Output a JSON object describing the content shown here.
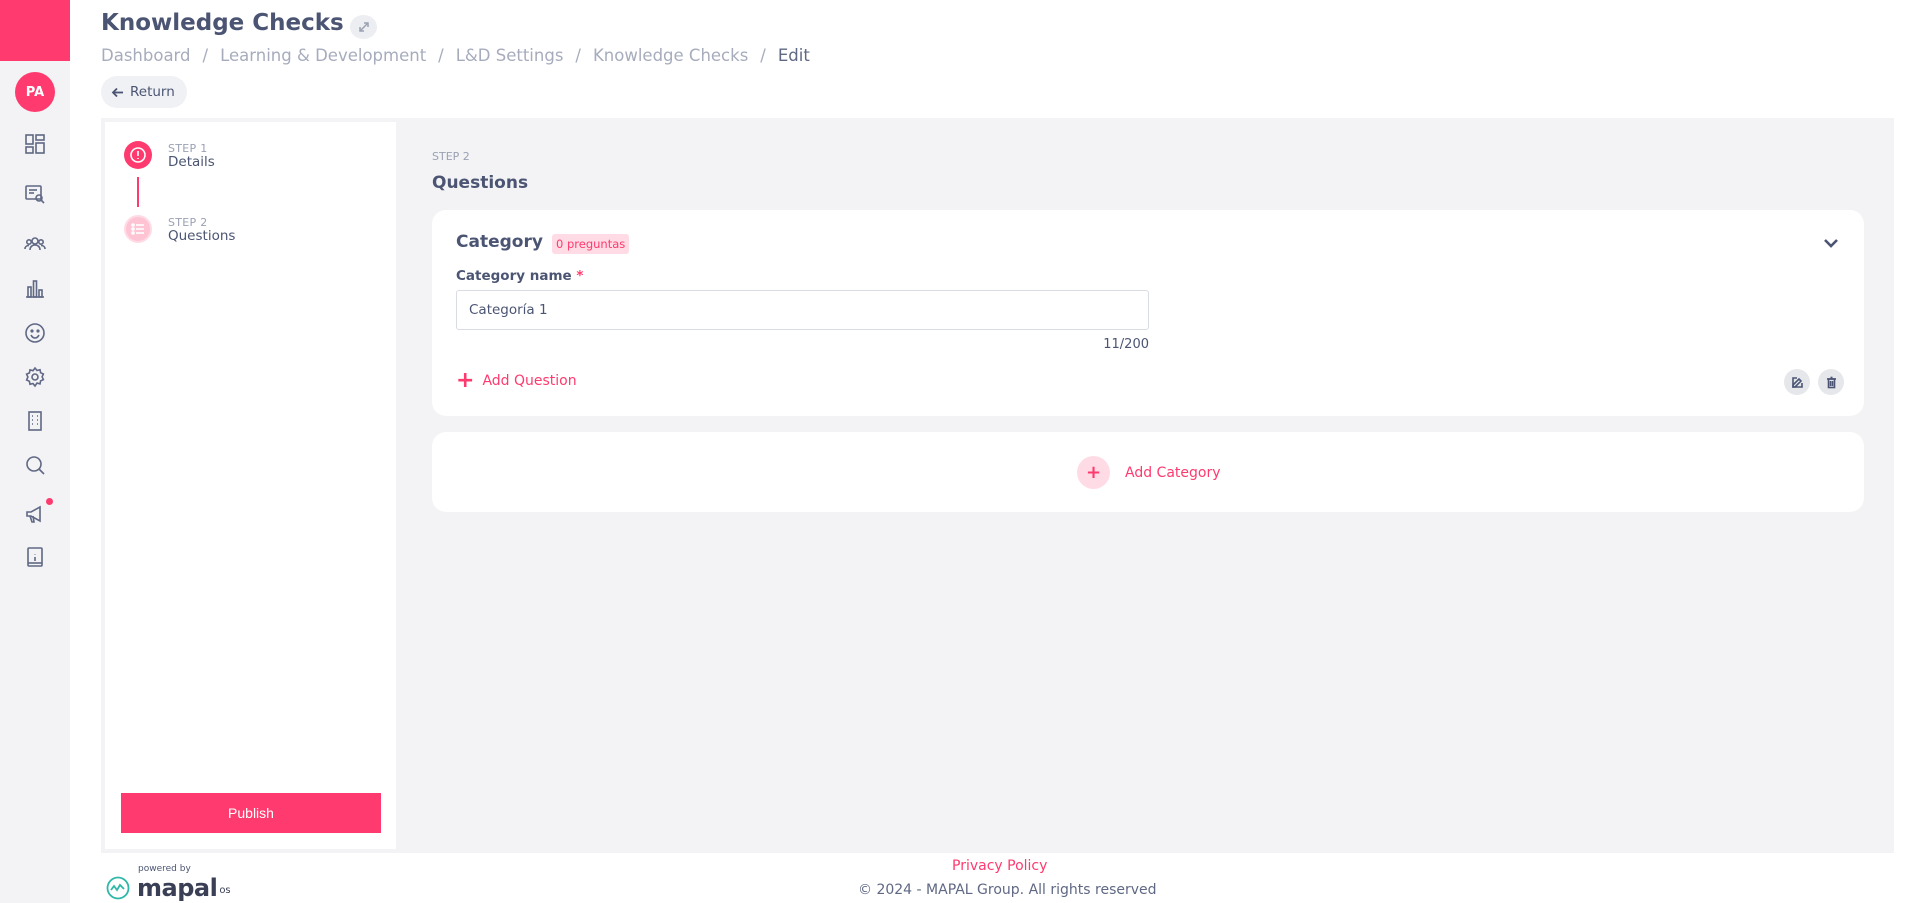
{
  "header": {
    "title": "Knowledge Checks",
    "breadcrumb": [
      "Dashboard",
      "Learning & Development",
      "L&D Settings",
      "Knowledge Checks",
      "Edit"
    ],
    "return_label": "Return"
  },
  "sidebar": {
    "avatar_initials": "PA",
    "icons": [
      "dashboard-icon",
      "search-document-icon",
      "people-icon",
      "chart-icon",
      "smile-icon",
      "settings-icon",
      "building-icon",
      "search-icon",
      "megaphone-icon",
      "info-book-icon"
    ]
  },
  "steps": [
    {
      "sub": "STEP 1",
      "label": "Details"
    },
    {
      "sub": "STEP 2",
      "label": "Questions"
    }
  ],
  "publish_label": "Publish",
  "main": {
    "step_label": "STEP 2",
    "title": "Questions",
    "category": {
      "title": "Category",
      "badge": "0 preguntas",
      "field_label": "Category name",
      "required_mark": "*",
      "input_value": "Categoría 1",
      "counter": "11/200",
      "add_question_label": "Add Question"
    },
    "add_category_label": "Add Category"
  },
  "footer": {
    "powered_by": "powered by",
    "logo_word": "mapal",
    "logo_suffix": "os",
    "privacy": "Privacy Policy",
    "copyright": "© 2024 - MAPAL Group. All rights reserved"
  },
  "colors": {
    "accent": "#ff3a6e",
    "text": "#4b5573",
    "muted": "#a7acbd",
    "panel_bg": "#f3f3f5"
  }
}
